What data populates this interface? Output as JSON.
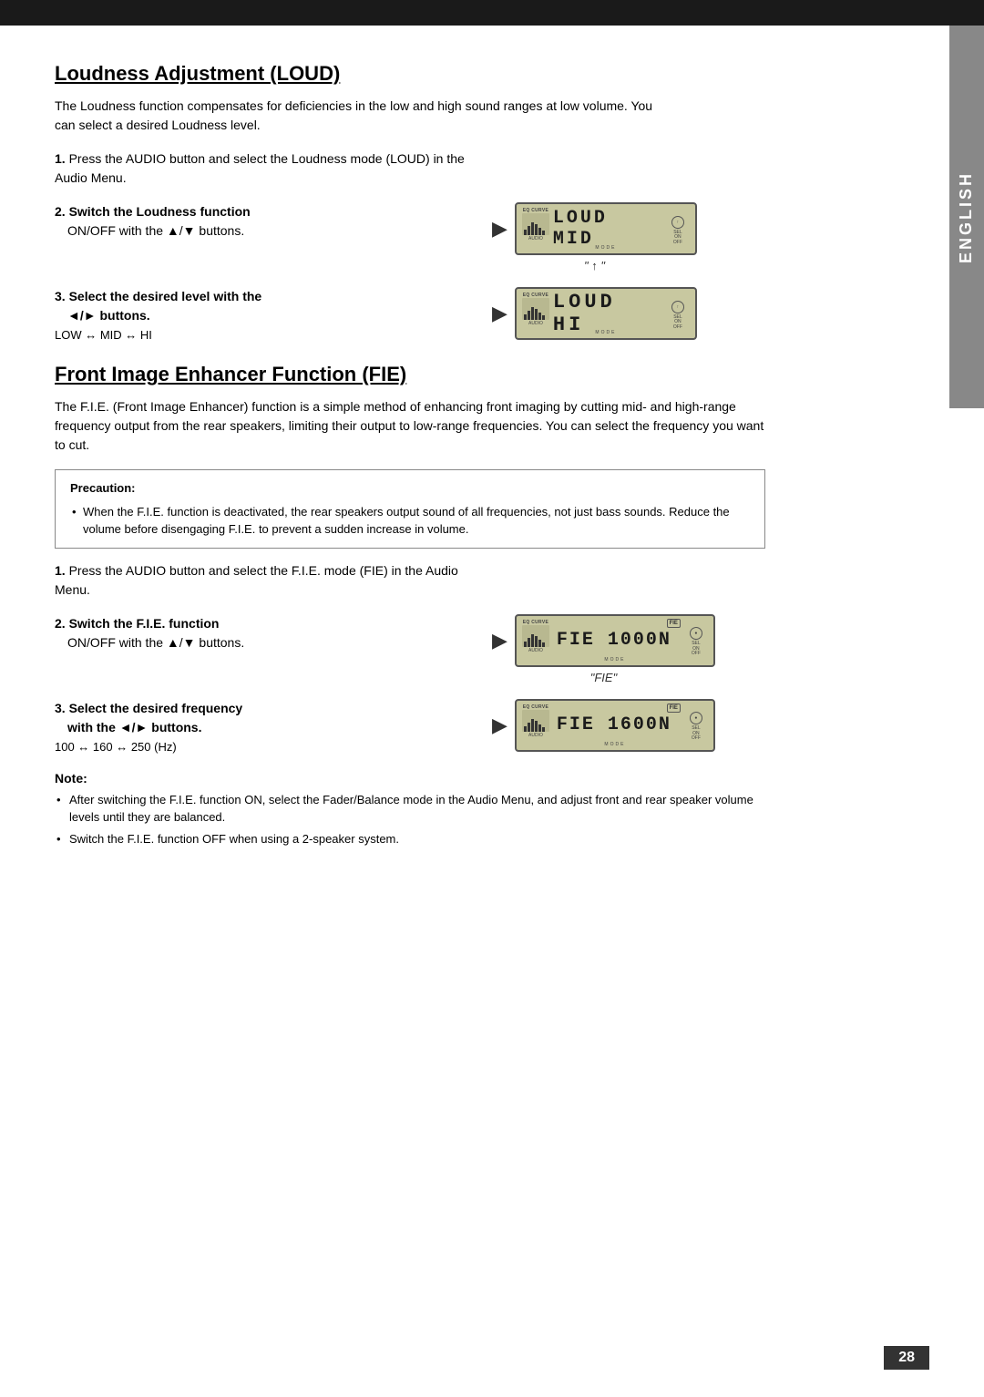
{
  "page": {
    "top_bar_color": "#1a1a1a",
    "side_tab_text": "ENGLISH",
    "page_number": "28"
  },
  "loud_section": {
    "title": "Loudness Adjustment (LOUD)",
    "description": "The Loudness function compensates for deficiencies in the low and high sound ranges at low volume. You can select a desired Loudness level.",
    "step1": {
      "number": "1.",
      "text": "Press the AUDIO button and select the Loudness mode (LOUD) in the Audio Menu."
    },
    "step2": {
      "number": "2.",
      "text_bold": "Switch the Loudness function",
      "text_normal": "ON/OFF with the ▲/▼ buttons.",
      "display_text": "LOUD MID",
      "caption": "\" ↑ \""
    },
    "step3": {
      "number": "3.",
      "text_bold": "Select the desired level with the",
      "text_normal": "◄/► buttons.",
      "levels": "LOW ↔ MID ↔ HI",
      "display_text": "LOUD HI"
    }
  },
  "fie_section": {
    "title": "Front Image Enhancer Function (FIE)",
    "description": "The F.I.E. (Front Image Enhancer) function is a simple method of enhancing front imaging by cutting mid- and high-range frequency output from the rear speakers, limiting their output to low-range frequencies. You can select the frequency you want to cut.",
    "precaution": {
      "title": "Precaution:",
      "items": [
        "When the F.I.E. function is deactivated, the rear speakers output sound of all frequencies, not just bass sounds. Reduce the volume before disengaging F.I.E. to prevent a sudden increase in volume."
      ]
    },
    "step1": {
      "number": "1.",
      "text": "Press the AUDIO button and select the F.I.E. mode (FIE) in the Audio Menu."
    },
    "step2": {
      "number": "2.",
      "text_bold": "Switch the F.I.E. function",
      "text_normal": "ON/OFF with the ▲/▼ buttons.",
      "display_text": "FIE 1000N",
      "caption": "\"FIE\""
    },
    "step3": {
      "number": "3.",
      "text_bold": "Select the desired frequency",
      "text_normal": "with the ◄/► buttons.",
      "levels": "100 ↔ 160 ↔ 250 (Hz)",
      "display_text": "FIE 1600N"
    },
    "note": {
      "title": "Note:",
      "items": [
        "After switching the F.I.E. function ON, select the Fader/Balance mode in the Audio Menu, and adjust front and rear speaker volume levels until they are balanced.",
        "Switch the F.I.E. function OFF when using a 2-speaker system."
      ]
    }
  },
  "lcd_labels": {
    "eq_curve": "EQ CURVE",
    "audio": "AUDIO",
    "mode": "MODE",
    "sel": "SEL",
    "on": "ON",
    "off": "OFF"
  }
}
